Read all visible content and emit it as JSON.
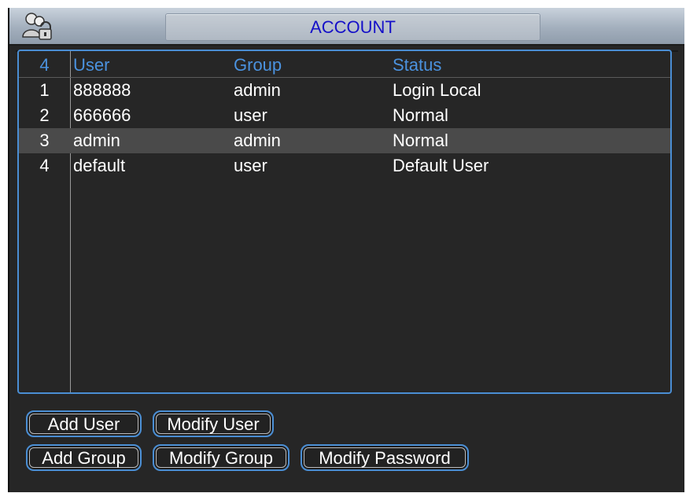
{
  "window": {
    "title": "ACCOUNT",
    "icon": "users-lock-icon"
  },
  "table": {
    "header": {
      "count": "4",
      "user": "User",
      "group": "Group",
      "status": "Status"
    },
    "rows": [
      {
        "index": "1",
        "user": "888888",
        "group": "admin",
        "status": "Login Local",
        "selected": false
      },
      {
        "index": "2",
        "user": "666666",
        "group": "user",
        "status": "Normal",
        "selected": false
      },
      {
        "index": "3",
        "user": "admin",
        "group": "admin",
        "status": "Normal",
        "selected": true
      },
      {
        "index": "4",
        "user": "default",
        "group": "user",
        "status": "Default User",
        "selected": false
      }
    ]
  },
  "buttons": {
    "add_user": "Add User",
    "modify_user": "Modify User",
    "add_group": "Add Group",
    "modify_group": "Modify Group",
    "modify_password": "Modify Password"
  },
  "colors": {
    "accent": "#4a8ed4",
    "title_text": "#1510c8",
    "header_text": "#4b92de",
    "background": "#262626",
    "selected_row": "#4a4a4a"
  }
}
